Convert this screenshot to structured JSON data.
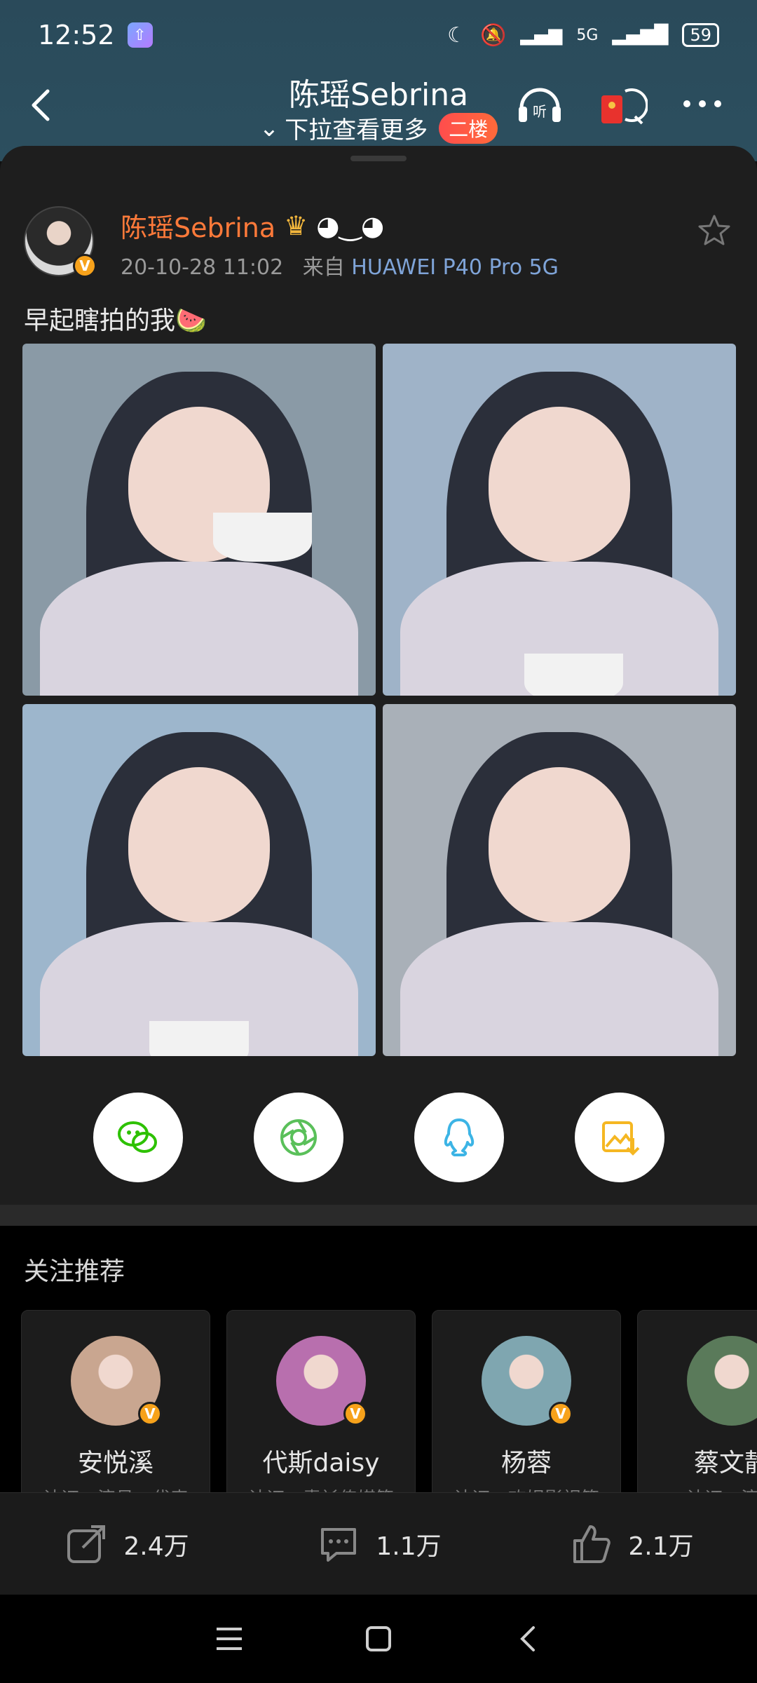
{
  "status": {
    "time": "12:52",
    "network": "5G",
    "battery": "59"
  },
  "header": {
    "title": "陈瑶Sebrina",
    "subtitle": "下拉查看更多",
    "badge": "二楼"
  },
  "post": {
    "author_name": "陈瑶Sebrina",
    "date": "20-10-28 11:02",
    "source_prefix": "来自",
    "device": "HUAWEI P40 Pro 5G",
    "text": "早起瞎拍的我🍉",
    "badge_letter": "V"
  },
  "photos": [
    {
      "bg": "#8a9aa6"
    },
    {
      "bg": "#9fb3c8"
    },
    {
      "bg": "#9db6cc"
    },
    {
      "bg": "#a9b0b8"
    }
  ],
  "share": [
    {
      "icon": "wechat-icon",
      "color": "#2dc100"
    },
    {
      "icon": "moments-icon",
      "color": "#5ac05a"
    },
    {
      "icon": "qq-icon",
      "color": "#3cb4e5"
    },
    {
      "icon": "save-image-icon",
      "color": "#f5b722"
    }
  ],
  "recommend": {
    "title": "关注推荐",
    "users": [
      {
        "name": "安悦溪",
        "desc": "认证：演员、代表",
        "avatar_color": "#c9a690"
      },
      {
        "name": "代斯daisy",
        "desc": "认证：青衫传媒签",
        "avatar_color": "#b86fae"
      },
      {
        "name": "杨蓉",
        "desc": "认证：欢娱影视签",
        "avatar_color": "#7fa6b0"
      },
      {
        "name": "蔡文静",
        "desc": "认证：演员",
        "avatar_color": "#5a7a5a"
      }
    ]
  },
  "actions": {
    "repost": "2.4万",
    "comment": "1.1万",
    "like": "2.1万"
  }
}
